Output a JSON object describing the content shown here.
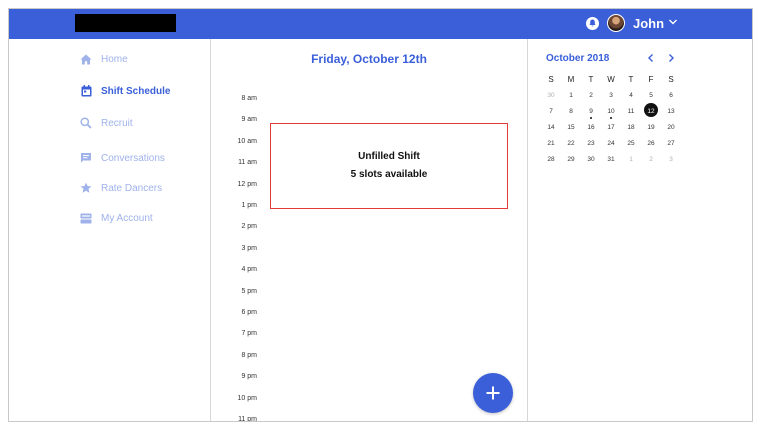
{
  "header": {
    "user_name": "John",
    "accent": "#3a5fd9",
    "logo": "logo-redacted"
  },
  "sidebar": {
    "items": [
      {
        "label": "Home",
        "icon": "home-icon",
        "active": false
      },
      {
        "label": "Shift Schedule",
        "icon": "calendar-icon",
        "active": true
      },
      {
        "label": "Recruit",
        "icon": "search-icon",
        "active": false
      },
      {
        "label": "Conversations",
        "icon": "chat-icon",
        "active": false
      },
      {
        "label": "Rate Dancers",
        "icon": "star-icon",
        "active": false
      },
      {
        "label": "My Account",
        "icon": "account-icon",
        "active": false
      }
    ]
  },
  "schedule": {
    "day_title": "Friday, October 12th",
    "times": [
      "8 am",
      "9 am",
      "10 am",
      "11 am",
      "12 pm",
      "1 pm",
      "2 pm",
      "3 pm",
      "4 pm",
      "5 pm",
      "6 pm",
      "7 pm",
      "8 pm",
      "9 pm",
      "10 pm",
      "11 pm"
    ],
    "shift": {
      "title": "Unfilled Shift",
      "slots": "5 slots available",
      "border_color": "#e53935"
    }
  },
  "calendar": {
    "month_label": "October 2018",
    "weekdays": [
      "S",
      "M",
      "T",
      "W",
      "T",
      "F",
      "S"
    ],
    "selected_day": "12",
    "weeks": [
      [
        {
          "d": "30",
          "m": true
        },
        {
          "d": "1"
        },
        {
          "d": "2"
        },
        {
          "d": "3"
        },
        {
          "d": "4"
        },
        {
          "d": "5"
        },
        {
          "d": "6"
        }
      ],
      [
        {
          "d": "7"
        },
        {
          "d": "8"
        },
        {
          "d": "9",
          "dot": true
        },
        {
          "d": "10",
          "dot": true
        },
        {
          "d": "11"
        },
        {
          "d": "12",
          "sel": true,
          "dot": true
        },
        {
          "d": "13"
        }
      ],
      [
        {
          "d": "14"
        },
        {
          "d": "15"
        },
        {
          "d": "16"
        },
        {
          "d": "17"
        },
        {
          "d": "18"
        },
        {
          "d": "19"
        },
        {
          "d": "20"
        }
      ],
      [
        {
          "d": "21"
        },
        {
          "d": "22"
        },
        {
          "d": "23"
        },
        {
          "d": "24"
        },
        {
          "d": "25"
        },
        {
          "d": "26"
        },
        {
          "d": "27"
        }
      ],
      [
        {
          "d": "28"
        },
        {
          "d": "29"
        },
        {
          "d": "30"
        },
        {
          "d": "31"
        },
        {
          "d": "1",
          "m": true
        },
        {
          "d": "2",
          "m": true
        },
        {
          "d": "3",
          "m": true
        }
      ]
    ]
  }
}
